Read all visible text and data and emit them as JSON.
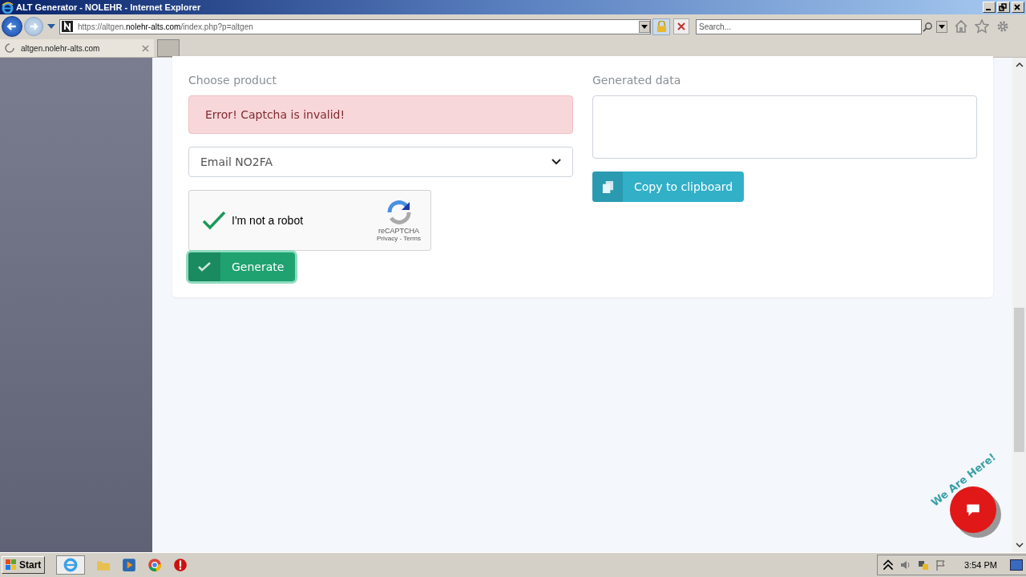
{
  "window": {
    "title": "ALT Generator - NOLEHR - Internet Explorer"
  },
  "address_bar": {
    "scheme": "https://",
    "subdomain": "altgen.",
    "domain": "nolehr-alts.com",
    "path": "/index.php?p=altgen"
  },
  "search": {
    "placeholder": "Search..."
  },
  "tabs": [
    {
      "label": "altgen.nolehr-alts.com",
      "selected": true
    }
  ],
  "form": {
    "product_label": "Choose product",
    "error": "Error! Captcha is invalid!",
    "product_value": "Email NO2FA",
    "captcha": {
      "label": "I'm not a robot",
      "checked": true,
      "brand": "reCAPTCHA",
      "links": "Privacy - Terms"
    },
    "generate_button": "Generate",
    "output_label": "Generated data",
    "copy_button": "Copy to clipboard"
  },
  "chat_widget": {
    "label": "We Are Here!"
  },
  "taskbar": {
    "start": "Start",
    "clock": "3:54 PM"
  }
}
